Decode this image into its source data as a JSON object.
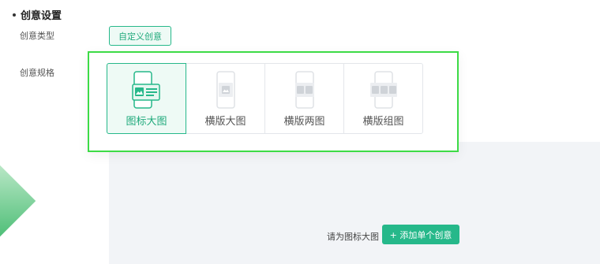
{
  "section": {
    "title": "创意设置"
  },
  "labels": {
    "type": "创意类型",
    "spec": "创意规格"
  },
  "type_button": {
    "label": "自定义创意"
  },
  "spec_options": [
    {
      "label": "图标大图",
      "selected": true,
      "icon": "icon-large-image"
    },
    {
      "label": "横版大图",
      "selected": false,
      "icon": "landscape-large-image"
    },
    {
      "label": "横版两图",
      "selected": false,
      "icon": "landscape-two-images"
    },
    {
      "label": "横版组图",
      "selected": false,
      "icon": "landscape-image-group"
    }
  ],
  "footer": {
    "hint": "请为图标大图",
    "add_button": "+ 添加单个创意"
  },
  "colors": {
    "accent": "#26b88a",
    "accent_light": "#eefaf5",
    "highlight_border": "#3ddb46",
    "panel_bg": "#f2f4f7"
  }
}
